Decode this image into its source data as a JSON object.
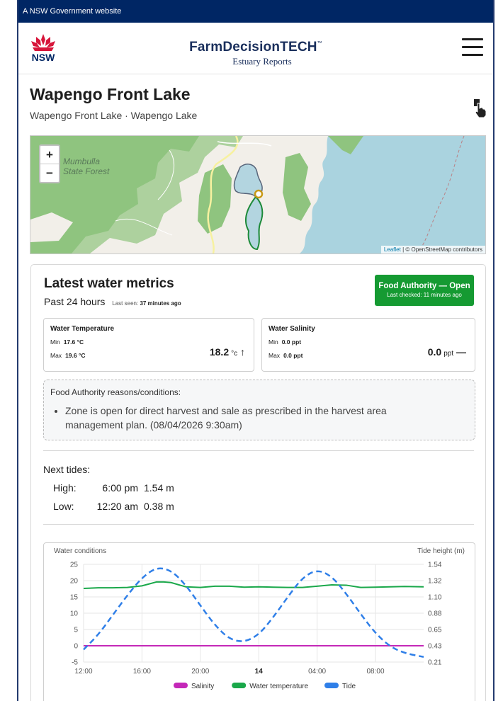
{
  "gov_banner": "A NSW Government website",
  "header": {
    "logo_text": "NSW",
    "brand_title": "FarmDecisionTECH",
    "brand_tm": "™",
    "brand_subtitle": "Estuary Reports"
  },
  "site": {
    "title": "Wapengo Front Lake",
    "subtitle": "Wapengo Front Lake · Wapengo Lake"
  },
  "map": {
    "zoom_in": "+",
    "zoom_out": "−",
    "label_line1": "Mumbulla",
    "label_line2": "State Forest",
    "attribution_leaflet": "Leaflet",
    "attribution_rest": " | © OpenStreetMap contributors"
  },
  "metrics": {
    "title": "Latest water metrics",
    "period": "Past 24 hours",
    "last_seen_label": "Last seen:",
    "last_seen_value": "37 minutes ago",
    "badge_title": "Food Authority — Open",
    "badge_sub": "Last checked: 11 minutes ago",
    "status_color": "#159a32",
    "temperature": {
      "label": "Water Temperature",
      "min_label": "Min",
      "min_value": "17.6 °C",
      "max_label": "Max",
      "max_value": "19.6 °C",
      "current": "18.2",
      "unit": "°c",
      "trend": "↑"
    },
    "salinity": {
      "label": "Water Salinity",
      "min_label": "Min",
      "min_value": "0.0 ppt",
      "max_label": "Max",
      "max_value": "0.0 ppt",
      "current": "0.0",
      "unit": "ppt",
      "trend": "—"
    },
    "reasons_title": "Food Authority reasons/conditions:",
    "reasons_item": "Zone is open for direct harvest and sale as prescribed in the harvest area management plan. (08/04/2026 9:30am)"
  },
  "tides": {
    "title": "Next tides:",
    "high_label": "High:",
    "high_time": "6:00 pm",
    "high_height": "1.54 m",
    "low_label": "Low:",
    "low_time": "12:20 am",
    "low_height": "0.38 m"
  },
  "chart_data": {
    "type": "line",
    "left_axis_label": "Water conditions",
    "right_axis_label": "Tide height (m)",
    "x_ticks": [
      "12:00",
      "16:00",
      "20:00",
      "14",
      "04:00",
      "08:00"
    ],
    "x_ticks_hours": [
      0,
      4,
      8,
      12,
      16,
      20
    ],
    "x_range_hours": [
      0,
      23.3
    ],
    "y_left_ticks": [
      25,
      20,
      15,
      10,
      5,
      0,
      -5
    ],
    "y_left_range": [
      -5,
      25
    ],
    "y_right_ticks": [
      "1.54",
      "1.32",
      "1.10",
      "0.88",
      "0.65",
      "0.43",
      "0.21"
    ],
    "y_right_range": [
      0.21,
      1.54
    ],
    "series": [
      {
        "name": "Salinity",
        "axis": "left",
        "color": "#c428b8",
        "dash": false,
        "x": [
          0,
          23.3
        ],
        "y": [
          0.0,
          0.0
        ]
      },
      {
        "name": "Water temperature",
        "axis": "left",
        "color": "#1aa84a",
        "dash": false,
        "x": [
          0,
          1,
          2,
          3,
          4,
          4.5,
          5,
          5.5,
          6,
          7,
          8,
          9,
          10,
          11,
          12,
          13,
          14,
          15,
          16,
          17,
          18,
          19,
          20,
          21,
          22,
          23.3
        ],
        "y": [
          17.6,
          17.8,
          17.8,
          17.9,
          18.4,
          19.0,
          19.6,
          19.6,
          19.4,
          18.1,
          17.9,
          18.3,
          18.3,
          18.0,
          18.1,
          18.0,
          17.9,
          17.9,
          18.3,
          18.7,
          18.6,
          17.9,
          18.0,
          18.1,
          18.2,
          18.1
        ],
        "min_label": "Min",
        "max_label": "Max"
      },
      {
        "name": "Tide",
        "axis": "right",
        "color": "#2f7fe8",
        "dash": true,
        "x": [
          0,
          1,
          2,
          3,
          4,
          5,
          6,
          7,
          8,
          9,
          10,
          11,
          12,
          13,
          14,
          15,
          16,
          17,
          18,
          19,
          20,
          21,
          22,
          23.3
        ],
        "y": [
          0.38,
          0.58,
          0.85,
          1.12,
          1.36,
          1.5,
          1.46,
          1.26,
          0.98,
          0.71,
          0.52,
          0.48,
          0.58,
          0.82,
          1.1,
          1.36,
          1.47,
          1.38,
          1.14,
          0.86,
          0.6,
          0.42,
          0.33,
          0.28
        ]
      }
    ],
    "legend_position": "bottom"
  }
}
